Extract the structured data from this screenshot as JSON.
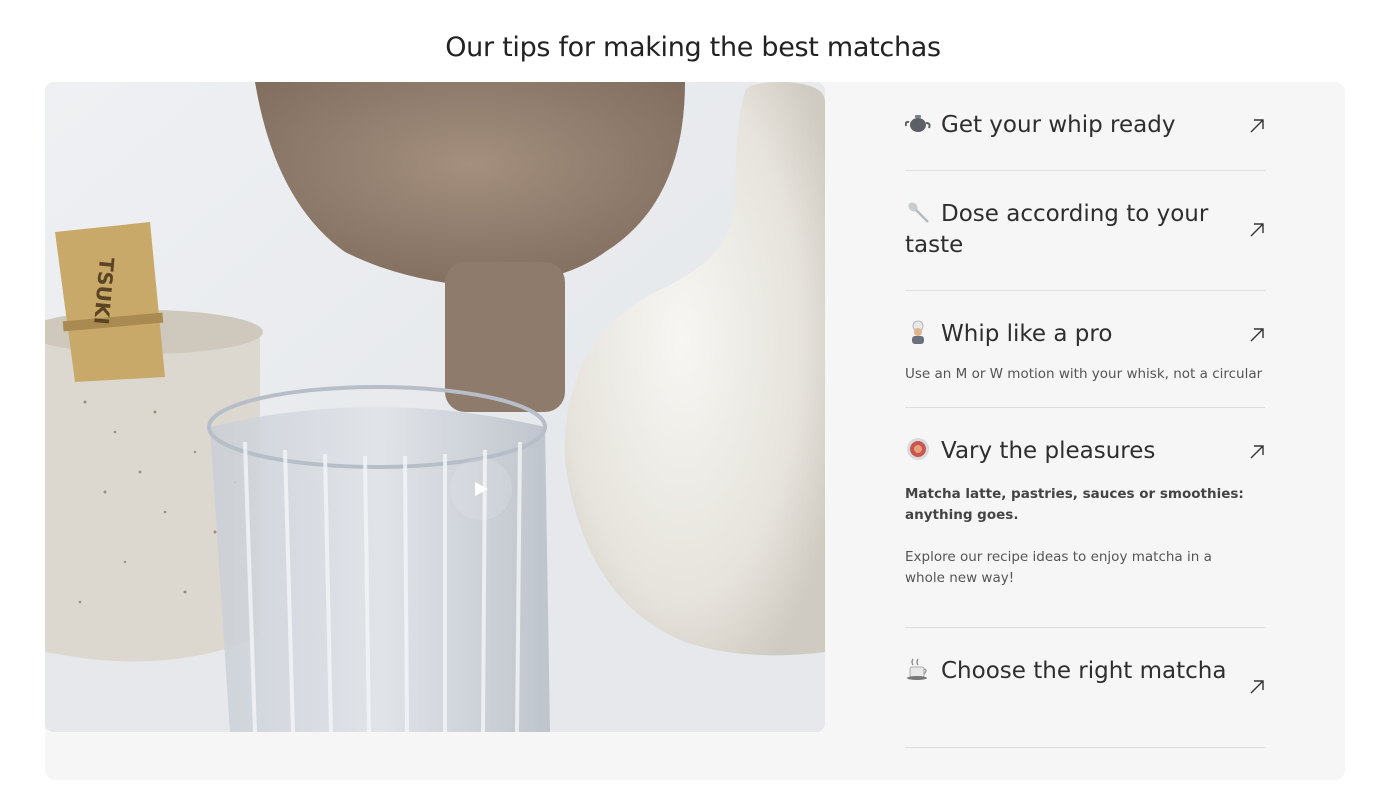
{
  "page": {
    "title": "Our tips for making the best matchas"
  },
  "video": {
    "play_icon": "play-icon",
    "cup_brand": "TSUKI"
  },
  "tips": [
    {
      "icon": "teapot-icon",
      "title": "Get your whip ready"
    },
    {
      "icon": "spoon-icon",
      "title": "Dose according to your taste"
    },
    {
      "icon": "chef-icon",
      "title": "Whip like a pro",
      "text": "Use an M or W motion with your whisk, not a circular"
    },
    {
      "icon": "plate-icon",
      "title": "Vary the pleasures",
      "bold_text": "Matcha latte, pastries, sauces or smoothies: anything goes.",
      "text": "Explore our recipe ideas to enjoy matcha in a whole new way!"
    },
    {
      "icon": "hot-beverage-icon",
      "title": "Choose the right matcha"
    }
  ],
  "colors": {
    "panel_bg": "#f6f6f6",
    "divider": "#dedede",
    "text": "#2e2e2e"
  }
}
